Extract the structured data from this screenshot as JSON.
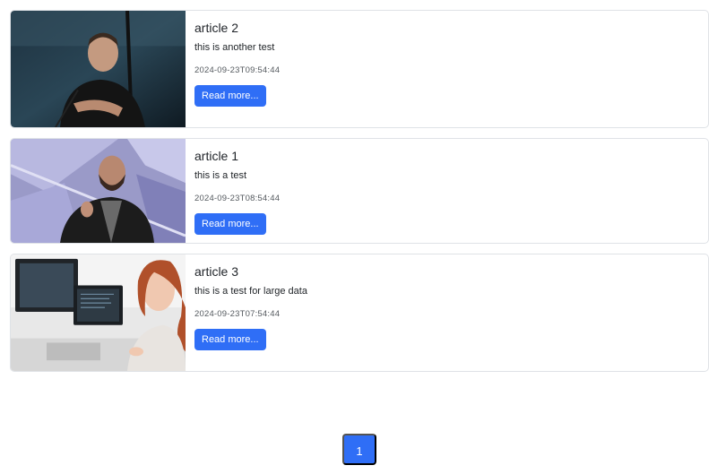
{
  "articles": [
    {
      "title": "article 2",
      "text": "this is another test",
      "date": "2024-09-23T09:54:44",
      "button_label": "Read more..."
    },
    {
      "title": "article 1",
      "text": "this is a test",
      "date": "2024-09-23T08:54:44",
      "button_label": "Read more..."
    },
    {
      "title": "article 3",
      "text": "this is a test for large data",
      "date": "2024-09-23T07:54:44",
      "button_label": "Read more..."
    }
  ],
  "pagination": {
    "current_page": "1"
  },
  "colors": {
    "primary": "#2f6ef6",
    "card_border": "#dfe2e6"
  }
}
